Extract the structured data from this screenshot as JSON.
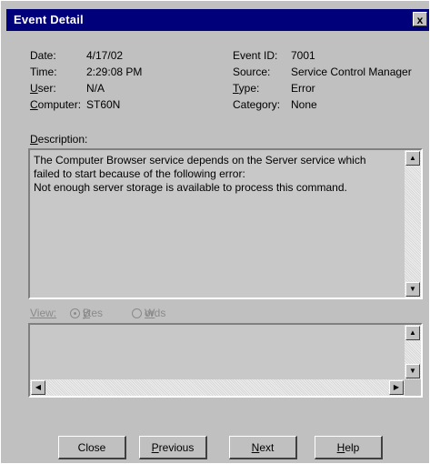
{
  "window": {
    "title": "Event Detail",
    "close_glyph": "x"
  },
  "fields": {
    "date": {
      "label": "Date:",
      "value": "4/17/02"
    },
    "time": {
      "label": "Time:",
      "value": "2:29:08 PM"
    },
    "user": {
      "label_u": "U",
      "label_rest": "ser:",
      "value": "N/A"
    },
    "computer": {
      "label_u": "C",
      "label_rest": "omputer:",
      "value": "ST60N"
    },
    "event_id": {
      "label": "Event ID:",
      "value": "7001"
    },
    "source": {
      "label": "Source:",
      "value": "Service Control Manager"
    },
    "type": {
      "label_u": "T",
      "label_rest": "ype:",
      "value": "Error"
    },
    "category": {
      "label": "Category:",
      "value": "None"
    }
  },
  "description": {
    "label_u": "D",
    "label_rest": "escription:",
    "text": "The Computer Browser service depends on the Server service which\nfailed to start because of the following error:\nNot enough server storage is available to process this command."
  },
  "data_view": {
    "label": "View:",
    "options": [
      {
        "label_u": "B",
        "label_rest": "ytes",
        "selected": true
      },
      {
        "label_u": "W",
        "label_rest": "ords",
        "selected": false
      }
    ]
  },
  "buttons": {
    "close": "Close",
    "previous_u": "P",
    "previous_rest": "revious",
    "next_u": "N",
    "next_rest": "ext",
    "help_u": "H",
    "help_rest": "elp"
  },
  "icons": {
    "scroll_up": "up-arrow-icon",
    "scroll_down": "down-arrow-icon",
    "scroll_left": "left-arrow-icon",
    "scroll_right": "right-arrow-icon"
  }
}
